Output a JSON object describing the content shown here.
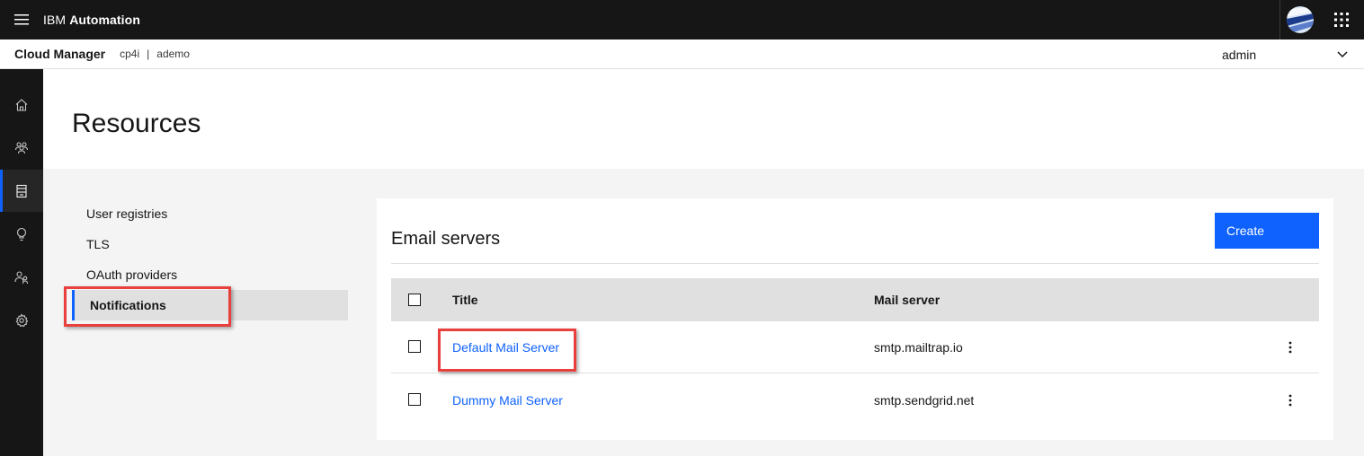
{
  "header": {
    "brand_prefix": "IBM",
    "brand_name": "Automation",
    "menu_icon": "hamburger-menu-icon",
    "avatar_icon": "user-avatar-icon",
    "switcher_icon": "app-switcher-icon"
  },
  "subheader": {
    "product": "Cloud Manager",
    "context": [
      "cp4i",
      "ademo"
    ],
    "separator": "|",
    "user": "admin"
  },
  "sidenav": {
    "items": [
      {
        "icon": "home-icon"
      },
      {
        "icon": "users-icon"
      },
      {
        "icon": "resources-icon",
        "active": true
      },
      {
        "icon": "idea-icon"
      },
      {
        "icon": "user-roles-icon"
      },
      {
        "icon": "settings-icon"
      }
    ]
  },
  "page": {
    "title": "Resources"
  },
  "resource_nav": {
    "items": [
      {
        "label": "User registries"
      },
      {
        "label": "TLS"
      },
      {
        "label": "OAuth providers"
      },
      {
        "label": "Notifications",
        "active": true
      }
    ]
  },
  "email_servers": {
    "title": "Email servers",
    "create_label": "Create",
    "columns": [
      "Title",
      "Mail server"
    ],
    "rows": [
      {
        "title": "Default Mail Server",
        "server": "smtp.mailtrap.io"
      },
      {
        "title": "Dummy Mail Server",
        "server": "smtp.sendgrid.net"
      }
    ]
  },
  "colors": {
    "accent": "#0f62fe",
    "highlight": "#e8413d",
    "shell": "#161616"
  }
}
